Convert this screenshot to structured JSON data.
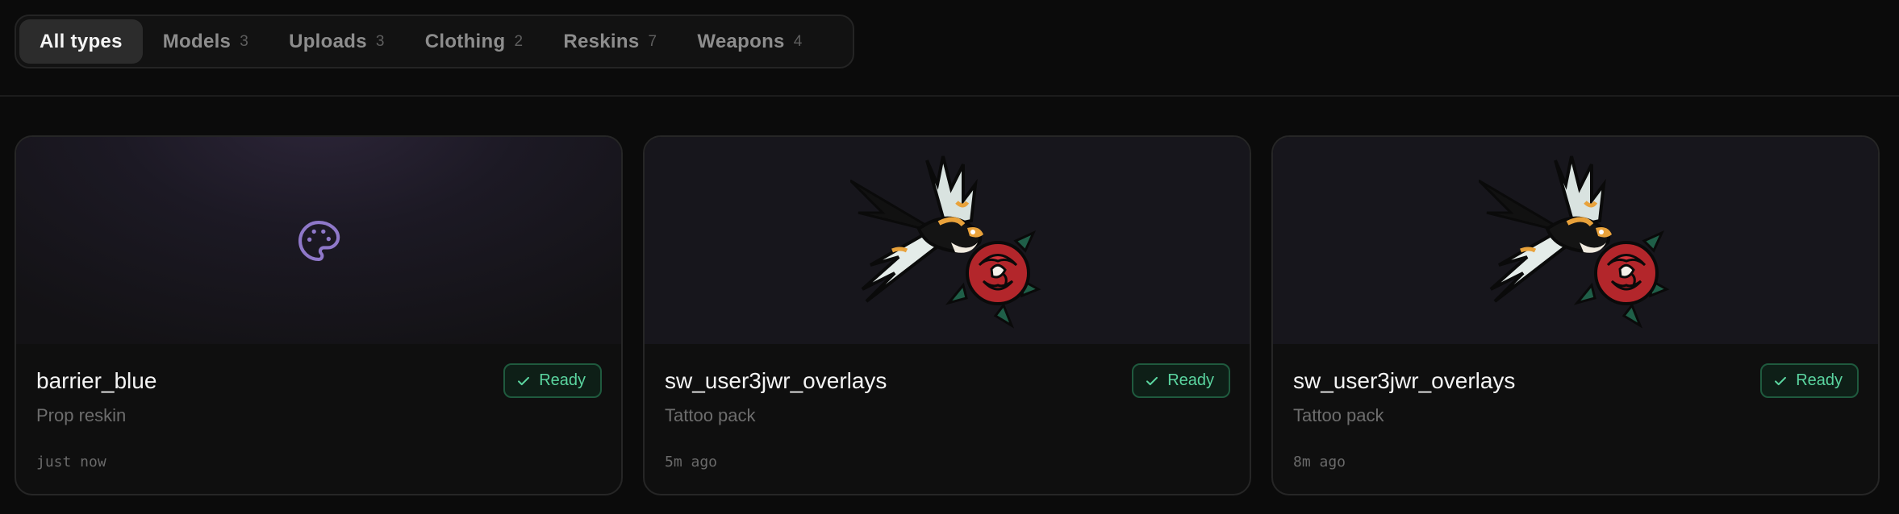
{
  "filters": [
    {
      "label": "All types",
      "count": "",
      "active": true
    },
    {
      "label": "Models",
      "count": "3"
    },
    {
      "label": "Uploads",
      "count": "3"
    },
    {
      "label": "Clothing",
      "count": "2"
    },
    {
      "label": "Reskins",
      "count": "7"
    },
    {
      "label": "Weapons",
      "count": "4"
    }
  ],
  "cards": [
    {
      "title": "barrier_blue",
      "subtitle": "Prop reskin",
      "time": "just now",
      "status": "Ready",
      "thumbnail": "palette-icon"
    },
    {
      "title": "sw_user3jwr_overlays",
      "subtitle": "Tattoo pack",
      "time": "5m ago",
      "status": "Ready",
      "thumbnail": "swallow-rose-tattoo"
    },
    {
      "title": "sw_user3jwr_overlays",
      "subtitle": "Tattoo pack",
      "time": "8m ago",
      "status": "Ready",
      "thumbnail": "swallow-rose-tattoo"
    }
  ],
  "colors": {
    "background": "#0b0b0b",
    "accent_purple": "#8f78c9",
    "status_green": "#5bd5a0"
  }
}
